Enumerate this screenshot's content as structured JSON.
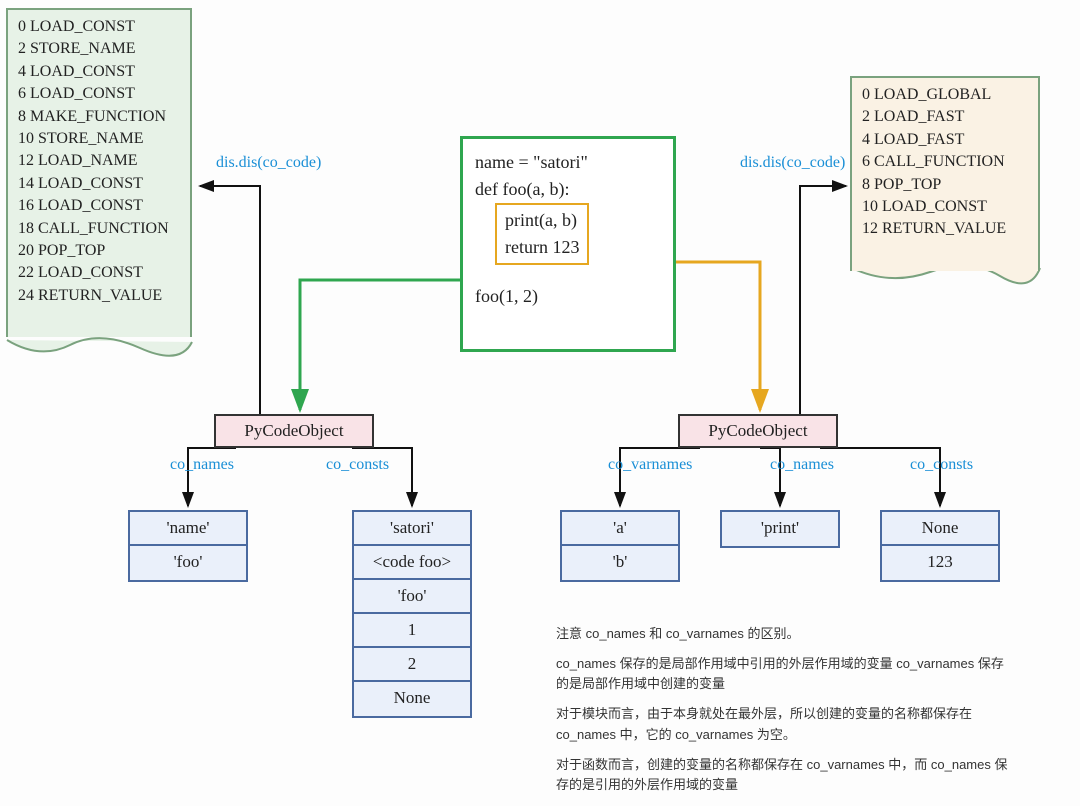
{
  "left_bytecode": [
    "0 LOAD_CONST",
    "2 STORE_NAME",
    "4 LOAD_CONST",
    "6 LOAD_CONST",
    "8 MAKE_FUNCTION",
    "10 STORE_NAME",
    "12 LOAD_NAME",
    "14 LOAD_CONST",
    "16 LOAD_CONST",
    "18 CALL_FUNCTION",
    "20 POP_TOP",
    "22 LOAD_CONST",
    "24 RETURN_VALUE"
  ],
  "right_bytecode": [
    "0 LOAD_GLOBAL",
    "2 LOAD_FAST",
    "4 LOAD_FAST",
    "6 CALL_FUNCTION",
    "8 POP_TOP",
    "10 LOAD_CONST",
    "12 RETURN_VALUE"
  ],
  "dis_label": "dis.dis(co_code)",
  "source": {
    "l1": "name = \"satori\"",
    "l2": "def foo(a, b):",
    "l3a": "print(a, b)",
    "l3b": "return 123",
    "l4": "foo(1, 2)"
  },
  "pycode_label": "PyCodeObject",
  "attrs": {
    "co_names": "co_names",
    "co_consts": "co_consts",
    "co_varnames": "co_varnames"
  },
  "left_co_names": [
    "'name'",
    "'foo'"
  ],
  "left_co_consts": [
    "'satori'",
    "<code foo>",
    "'foo'",
    "1",
    "2",
    "None"
  ],
  "right_co_varnames": [
    "'a'",
    "'b'"
  ],
  "right_co_names": [
    "'print'"
  ],
  "right_co_consts": [
    "None",
    "123"
  ],
  "notes": [
    "注意 co_names 和 co_varnames 的区别。",
    "co_names 保存的是局部作用域中引用的外层作用域的变量\nco_varnames 保存的是局部作用域中创建的变量",
    "对于模块而言，由于本身就处在最外层，所以创建的变量的名称都保存在 co_names 中，它的 co_varnames 为空。",
    "对于函数而言，创建的变量的名称都保存在 co_varnames 中，而 co_names 保存的是引用的外层作用域的变量"
  ]
}
